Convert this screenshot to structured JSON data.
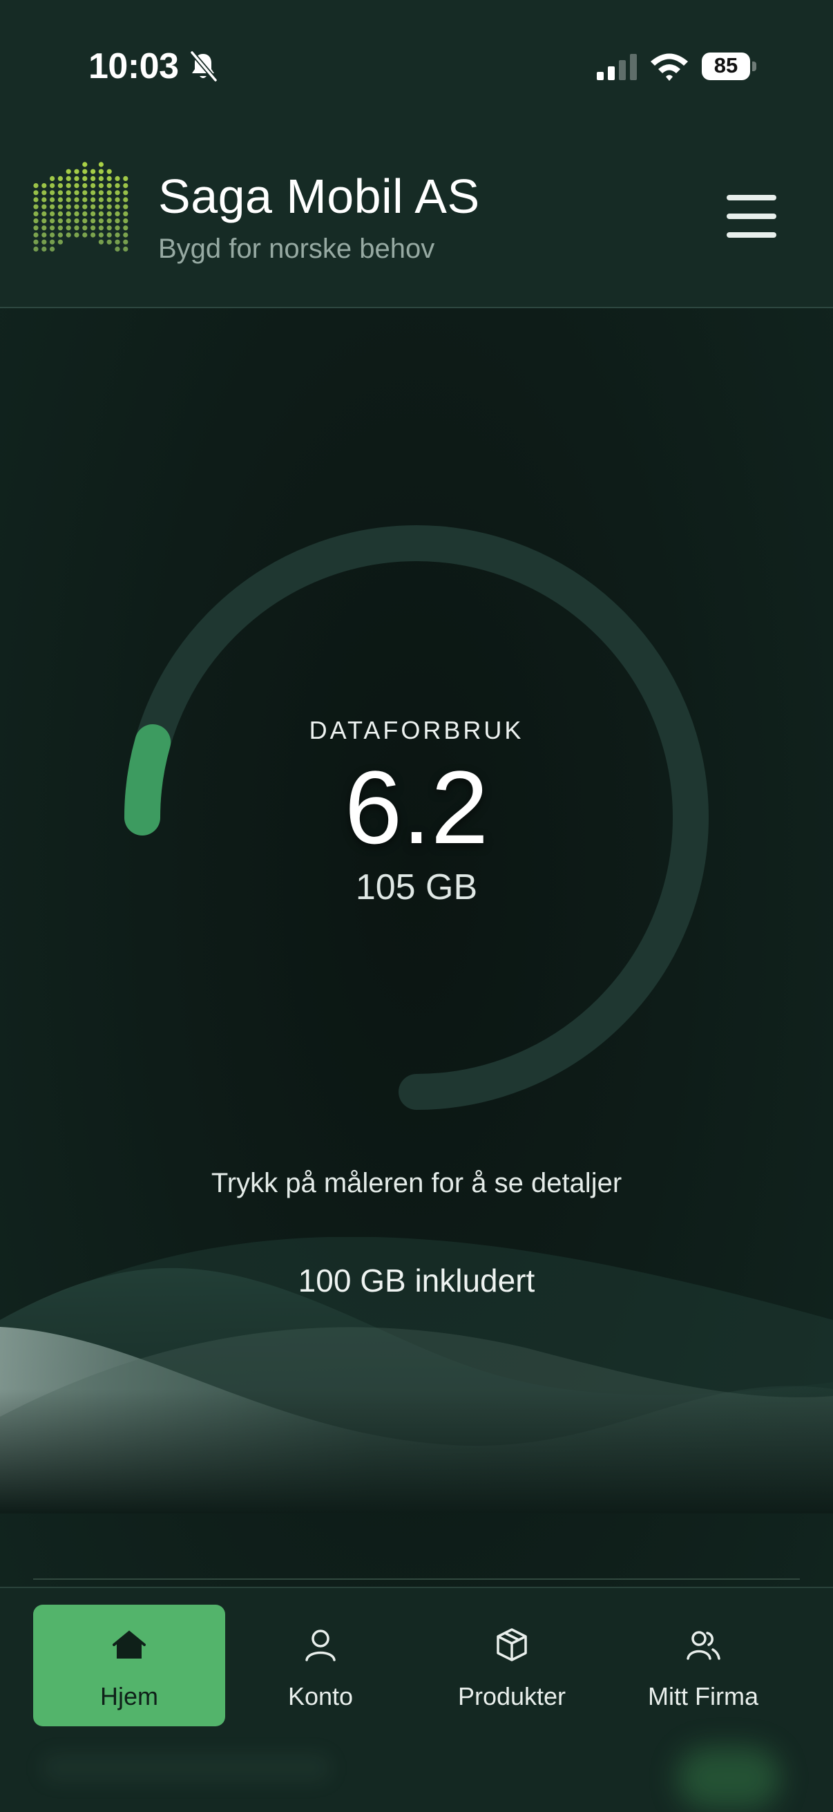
{
  "status_bar": {
    "time": "10:03",
    "battery": "85"
  },
  "header": {
    "title": "Saga Mobil AS",
    "subtitle": "Bygd for norske behov"
  },
  "gauge": {
    "label": "DATAFORBRUK",
    "value": "6.2",
    "total": "105 GB",
    "fill_fraction": 0.059,
    "track_color": "#1f3731",
    "fill_color": "#3d9b60"
  },
  "main": {
    "hint": "Trykk på måleren for å se detaljer",
    "included": "100 GB inkludert"
  },
  "nav": {
    "items": [
      {
        "label": "Hjem",
        "icon": "home-icon",
        "active": true
      },
      {
        "label": "Konto",
        "icon": "user-icon",
        "active": false
      },
      {
        "label": "Produkter",
        "icon": "box-icon",
        "active": false
      },
      {
        "label": "Mitt Firma",
        "icon": "users-icon",
        "active": false
      }
    ]
  },
  "colors": {
    "background": "#0e1c18",
    "header": "#162b25",
    "accent": "#53b46b"
  }
}
